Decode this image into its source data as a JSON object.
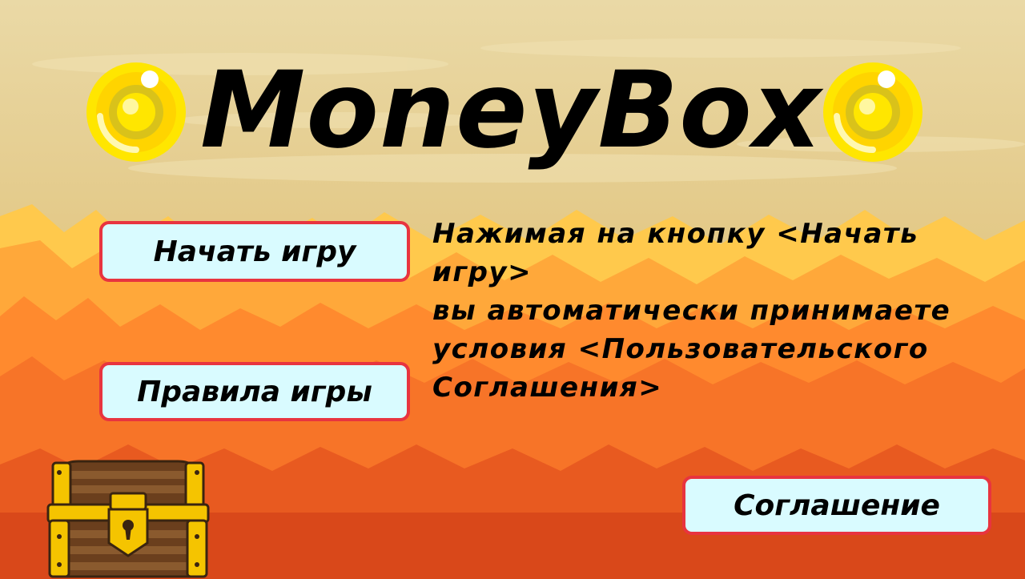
{
  "title": "MoneyBox",
  "menu": {
    "start_label": "Начать игру",
    "rules_label": "Правила игры",
    "agreement_label": "Соглашение"
  },
  "notice": {
    "lines": [
      "Нажимая на кнопку <Начать игру>",
      "вы автоматически принимаете",
      "условия <Пользовательского",
      "Соглашения>"
    ]
  },
  "icons": {
    "coin": "gold-coin-icon",
    "chest": "treasure-chest-icon"
  },
  "colors": {
    "button_fill": "#d9fbff",
    "button_border": "#e8343f",
    "coin_gold": "#ffe600",
    "sky_top": "#e8d39c",
    "mountain_far": "#ffc044",
    "mountain_mid": "#ff8a2a",
    "ground": "#d9481a"
  }
}
